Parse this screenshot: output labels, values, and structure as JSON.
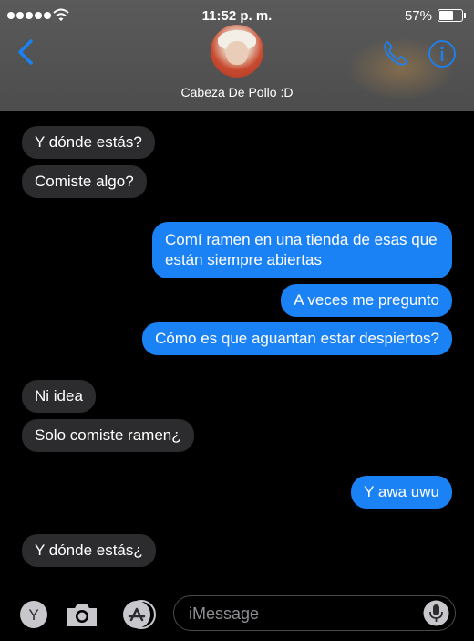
{
  "status_bar": {
    "time": "11:52 p. m.",
    "battery_percent": "57%",
    "battery_level": 0.57
  },
  "header": {
    "contact_name": "Cabeza De Pollo :D",
    "icons": {
      "back": "chevron-left-icon",
      "call": "phone-icon",
      "details": "info-icon"
    },
    "accent_color": "#1b82f5"
  },
  "messages": [
    {
      "direction": "received",
      "text": "Y dónde estás?"
    },
    {
      "direction": "received",
      "text": "Comiste algo?"
    },
    {
      "direction": "sent",
      "text": "Comí ramen en una tienda de esas que están siempre abiertas"
    },
    {
      "direction": "sent",
      "text": "A veces me pregunto"
    },
    {
      "direction": "sent",
      "text": "Cómo es que aguantan estar despiertos?"
    },
    {
      "direction": "received",
      "text": "Ni idea"
    },
    {
      "direction": "received",
      "text": "Solo comiste ramen¿"
    },
    {
      "direction": "sent",
      "text": "Y awa uwu"
    },
    {
      "direction": "received",
      "text": "Y dónde estás¿"
    }
  ],
  "composer": {
    "placeholder": "iMessage",
    "value": "",
    "app_buttons": [
      "y-app-icon",
      "camera-icon",
      "app-store-icon"
    ],
    "mic_icon": "microphone-icon"
  },
  "colors": {
    "sent_bubble": "#1b82f5",
    "received_bubble": "#2c2c2e",
    "background": "#000000"
  }
}
